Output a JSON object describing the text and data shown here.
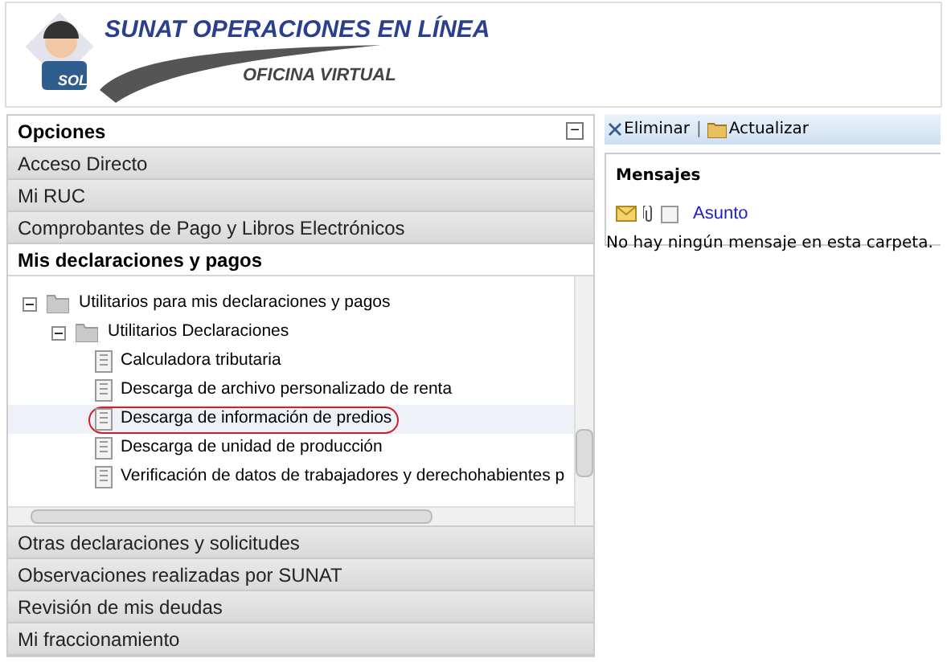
{
  "header": {
    "title": "SUNAT OPERACIONES EN LÍNEA",
    "subtitle": "OFICINA VIRTUAL",
    "logo_badge": "SOL"
  },
  "sidebar": {
    "title": "Opciones",
    "collapse_symbol": "−",
    "sections_before": [
      {
        "label": "Acceso Directo"
      },
      {
        "label": "Mi RUC"
      },
      {
        "label": "Comprobantes de Pago y Libros Electrónicos"
      }
    ],
    "active_section": {
      "label": "Mis declaraciones y pagos"
    },
    "tree": [
      {
        "label": "Utilitarios para mis declaraciones y pagos",
        "expanded": true,
        "children": [
          {
            "label": "Utilitarios Declaraciones",
            "expanded": true,
            "children": [
              {
                "label": "Calculadora tributaria",
                "selected": false,
                "circled": false
              },
              {
                "label": "Descarga de archivo personalizado de renta",
                "selected": false,
                "circled": false
              },
              {
                "label": "Descarga de información de predios",
                "selected": true,
                "circled": true
              },
              {
                "label": "Descarga de unidad de producción",
                "selected": false,
                "circled": false
              },
              {
                "label": "Verificación de datos de trabajadores y derechohabientes p",
                "selected": false,
                "circled": false
              }
            ]
          }
        ]
      }
    ],
    "sections_after": [
      {
        "label": "Otras declaraciones y solicitudes"
      },
      {
        "label": "Observaciones realizadas por SUNAT"
      },
      {
        "label": "Revisión de mis deudas"
      },
      {
        "label": "Mi fraccionamiento"
      }
    ]
  },
  "toolbar": {
    "buttons": [
      {
        "kind": "delete",
        "label": "Eliminar"
      },
      {
        "kind": "refresh",
        "label": "Actualizar"
      }
    ],
    "separator": "|"
  },
  "messages": {
    "title": "Mensajes",
    "subject_column": "Asunto",
    "select_all_checked": false,
    "empty_text": "No hay ningún mensaje en esta carpeta."
  }
}
